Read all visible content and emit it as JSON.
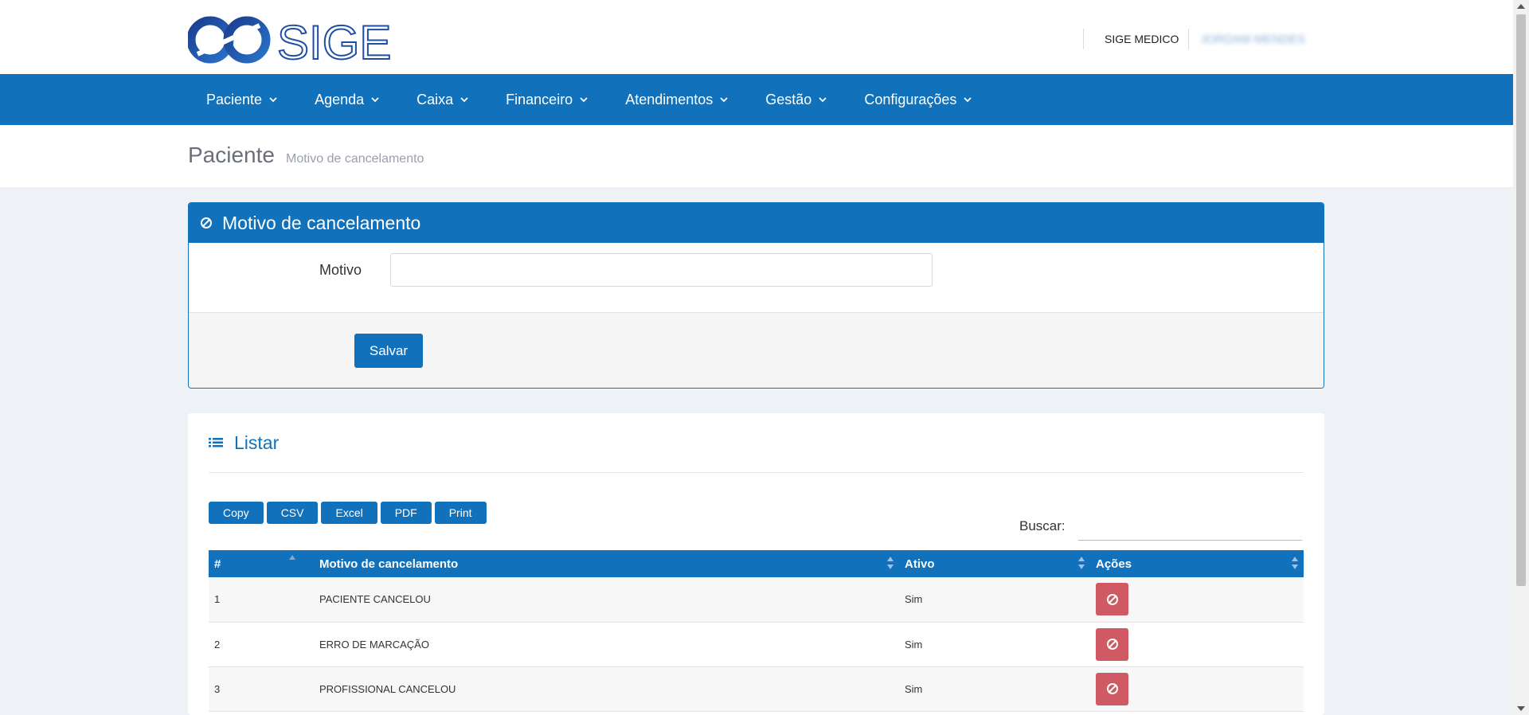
{
  "brand": {
    "name": "SIGE",
    "accent": "#1172bb"
  },
  "user": {
    "clinic": "SIGE MEDICO",
    "name": "JORDAM MENDES"
  },
  "nav": [
    {
      "label": "Paciente"
    },
    {
      "label": "Agenda"
    },
    {
      "label": "Caixa"
    },
    {
      "label": "Financeiro"
    },
    {
      "label": "Atendimentos"
    },
    {
      "label": "Gestão"
    },
    {
      "label": "Configurações"
    }
  ],
  "page": {
    "title": "Paciente",
    "subtitle": "Motivo de cancelamento"
  },
  "form": {
    "title": "Motivo de cancelamento",
    "icon": "ban-icon",
    "field_label": "Motivo",
    "field_value": "",
    "save_label": "Salvar"
  },
  "list": {
    "title": "Listar",
    "icon": "list-icon",
    "export_buttons": [
      "Copy",
      "CSV",
      "Excel",
      "PDF",
      "Print"
    ],
    "search_label": "Buscar:",
    "columns": [
      "#",
      "Motivo de cancelamento",
      "Ativo",
      "Ações"
    ],
    "rows": [
      {
        "id": "1",
        "motivo": "PACIENTE CANCELOU",
        "ativo": "Sim"
      },
      {
        "id": "2",
        "motivo": "ERRO DE MARCAÇÃO",
        "ativo": "Sim"
      },
      {
        "id": "3",
        "motivo": "PROFISSIONAL CANCELOU",
        "ativo": "Sim"
      }
    ],
    "cancel_color": "#d05a64"
  }
}
